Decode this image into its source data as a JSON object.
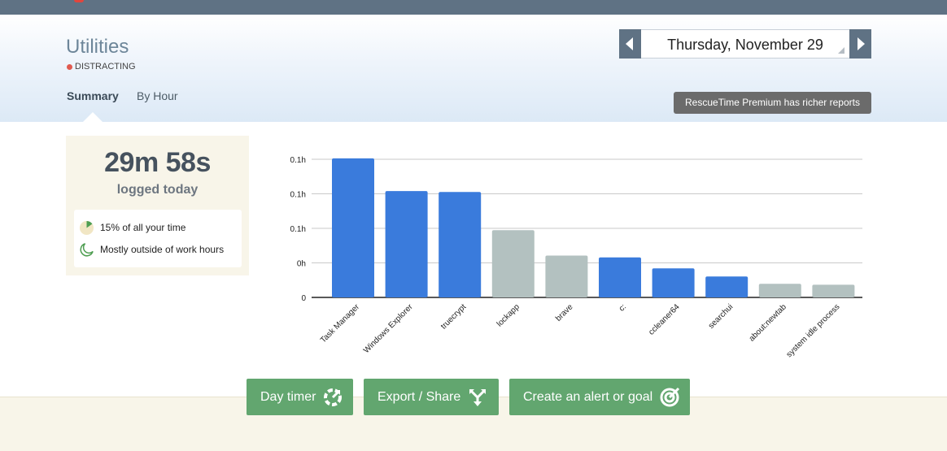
{
  "header": {
    "title": "Utilities",
    "category": "DISTRACTING",
    "category_color": "#e05a4f",
    "tabs": [
      {
        "label": "Summary",
        "active": true
      },
      {
        "label": "By Hour",
        "active": false
      }
    ],
    "date": "Thursday, November 29",
    "premium_label": "RescueTime Premium has richer reports"
  },
  "summary": {
    "total_time": "29m 58s",
    "total_sub": "logged today",
    "stats": [
      {
        "icon": "pie-percent-icon",
        "label": "15% of all your time"
      },
      {
        "icon": "moon-icon",
        "label": "Mostly outside of work hours"
      }
    ]
  },
  "chart_data": {
    "type": "bar",
    "categories": [
      "Task Manager",
      "Windows Explorer",
      "truecrypt",
      "lockapp",
      "brave",
      "c:",
      "ccleaner64",
      "searchui",
      "about:newtab",
      "system idle process"
    ],
    "values": [
      0.153,
      0.117,
      0.116,
      0.074,
      0.046,
      0.044,
      0.032,
      0.023,
      0.015,
      0.014
    ],
    "colors": [
      "#3a7bdc",
      "#3a7bdc",
      "#3a7bdc",
      "#b3c1c0",
      "#b3c1c0",
      "#3a7bdc",
      "#3a7bdc",
      "#3a7bdc",
      "#b3c1c0",
      "#b3c1c0"
    ],
    "y_tick_values": [
      0,
      0.038,
      0.076,
      0.114,
      0.152
    ],
    "y_tick_labels": [
      "0",
      "0h",
      "0.1h",
      "0.1h",
      "0.1h"
    ],
    "ylim": [
      0,
      0.152
    ],
    "grid": true,
    "xlabel": "",
    "ylabel": ""
  },
  "actions": [
    {
      "label": "Day timer",
      "icon": "timer-icon"
    },
    {
      "label": "Export / Share",
      "icon": "share-icon"
    },
    {
      "label": "Create an alert or goal",
      "icon": "target-icon"
    }
  ]
}
